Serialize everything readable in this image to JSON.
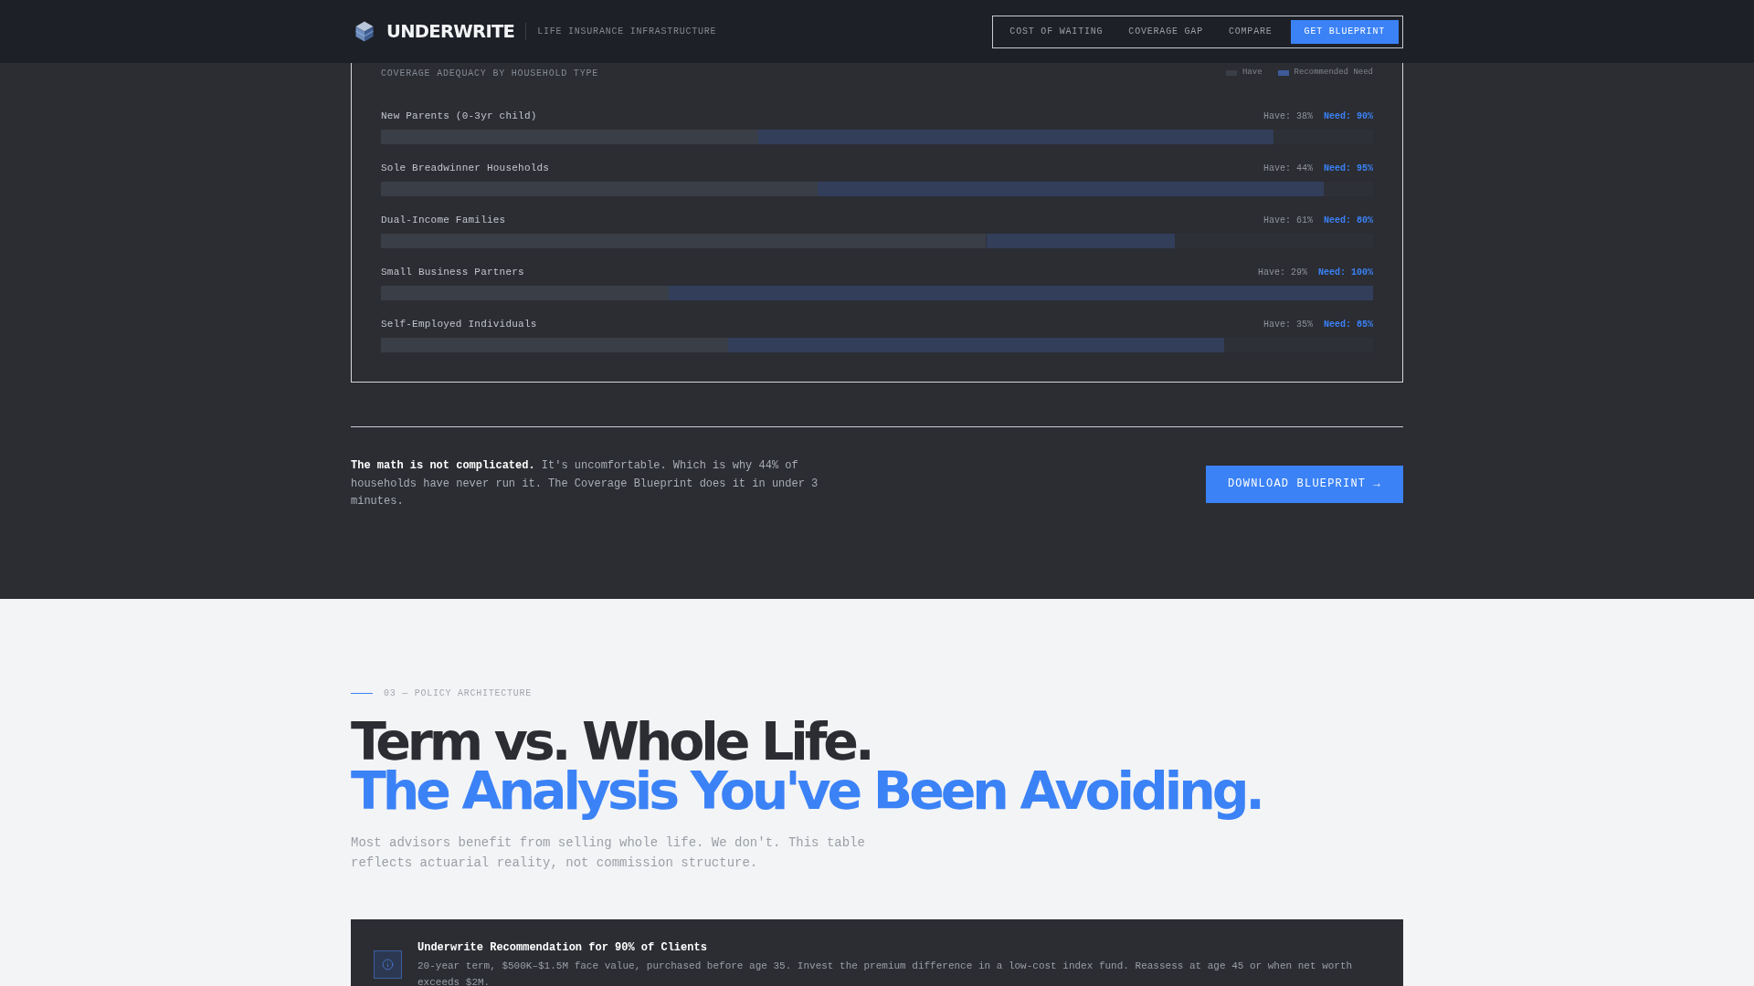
{
  "header": {
    "brand": "UNDERWRITE",
    "tagline": "LIFE INSURANCE INFRASTRUCTURE",
    "nav": [
      {
        "label": "COST OF WAITING",
        "kind": "link"
      },
      {
        "label": "COVERAGE GAP",
        "kind": "link"
      },
      {
        "label": "COMPARE",
        "kind": "link"
      },
      {
        "label": "GET BLUEPRINT",
        "kind": "button"
      }
    ]
  },
  "coverage_chart": {
    "title": "COVERAGE ADEQUACY BY HOUSEHOLD TYPE",
    "legend": [
      {
        "label": "Have",
        "color": "#3a3e47"
      },
      {
        "label": "Recommended Need",
        "color": "#3d5a99"
      }
    ],
    "rows": [
      {
        "label": "New Parents (0-3yr child)",
        "have": {
          "reading": "Have: 38%",
          "level": 0.38
        },
        "need": {
          "reading": "Need: 90%",
          "level": 0.9
        }
      },
      {
        "label": "Sole Breadwinner Households",
        "have": {
          "reading": "Have: 44%",
          "level": 0.44
        },
        "need": {
          "reading": "Need: 95%",
          "level": 0.95
        }
      },
      {
        "label": "Dual-Income Families",
        "have": {
          "reading": "Have: 61%",
          "level": 0.61
        },
        "need": {
          "reading": "Need: 80%",
          "level": 0.8
        }
      },
      {
        "label": "Small Business Partners",
        "have": {
          "reading": "Have: 29%",
          "level": 0.29
        },
        "need": {
          "reading": "Need: 100%",
          "level": 1
        }
      },
      {
        "label": "Self-Employed Individuals",
        "have": {
          "reading": "Have: 35%",
          "level": 0.35
        },
        "need": {
          "reading": "Need: 85%",
          "level": 0.85
        }
      }
    ]
  },
  "cta": {
    "text": "**The math is not complicated.** It's uncomfortable. Which is why 44% of households have never run it. The Coverage Blueprint does it in under 3 minutes.",
    "button": "DOWNLOAD BLUEPRINT →"
  },
  "policy_section": {
    "eyebrow": "03 — POLICY ARCHITECTURE",
    "title": "Term vs. Whole Life.",
    "title_highlight": "The Analysis You've Been Avoiding.",
    "description": "Most advisors benefit from selling whole life. We don't. This table reflects actuarial reality, not commission structure.",
    "recommendation": {
      "title": "Underwrite Recommendation for 90% of Clients",
      "text": "20-year term, $500K–$1.5M face value, purchased before age 35. Invest the premium difference in a low-cost index fund. Reassess at age 45 or when net worth exceeds $2M."
    }
  }
}
